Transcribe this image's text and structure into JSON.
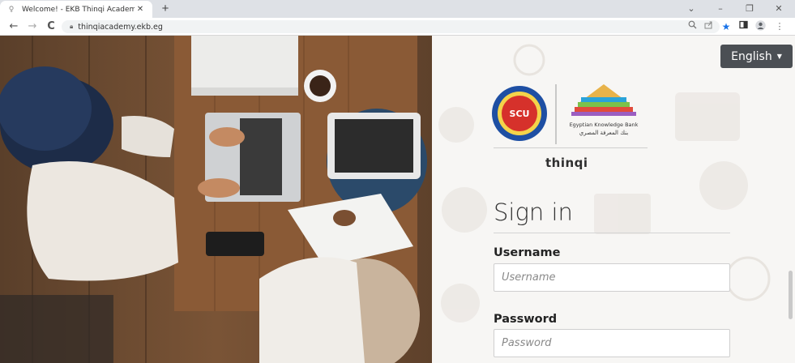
{
  "browser": {
    "tab_title": "Welcome! - EKB Thinqi Academy",
    "tab_close": "✕",
    "new_tab": "+",
    "url": "thinqiacademy.ekb.eg",
    "back": "←",
    "forward": "→",
    "reload": "C",
    "window_controls": {
      "chevron": "⌄",
      "minimize": "–",
      "restore": "❐",
      "close": "✕"
    }
  },
  "header": {
    "language_button": "English",
    "language_caret": "▼"
  },
  "logos": {
    "scu_text": "SCU",
    "ekb_english": "Egyptian Knowledge Bank",
    "ekb_arabic": "بنك المعرفة المصري"
  },
  "brand": {
    "name": "thinqi"
  },
  "form": {
    "title": "Sign in",
    "username_label": "Username",
    "username_placeholder": "Username",
    "password_label": "Password",
    "password_placeholder": "Password"
  },
  "colors": {
    "language_button_bg": "#4b4f54",
    "star_accent": "#1a73e8",
    "scu_blue": "#1e4fa3",
    "scu_red": "#d6312b"
  }
}
